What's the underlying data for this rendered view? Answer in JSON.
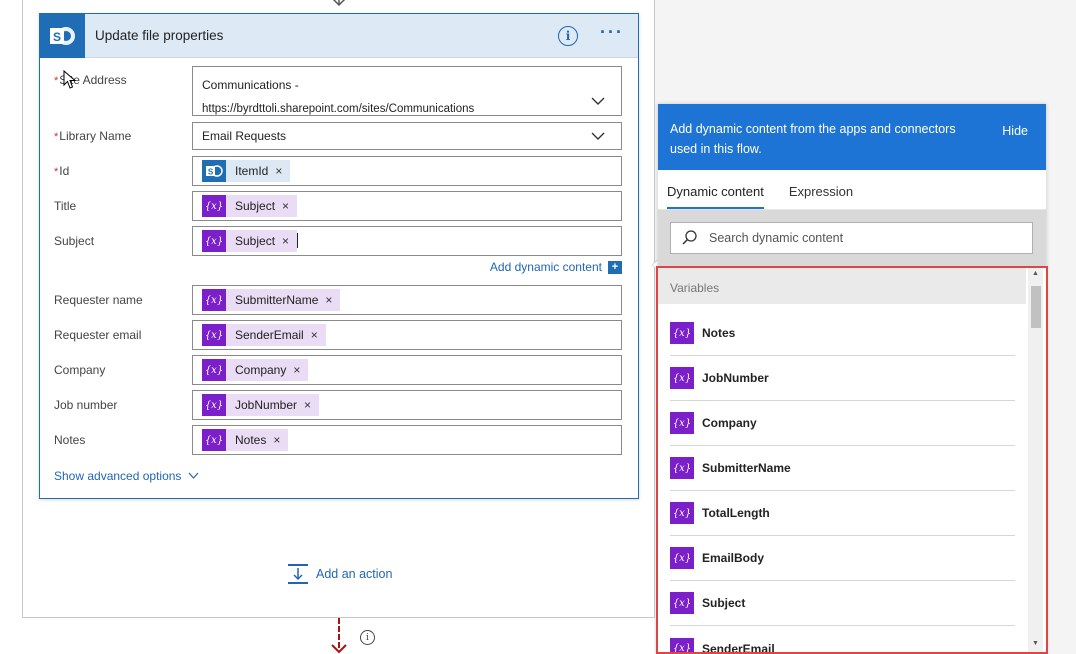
{
  "card": {
    "title": "Update file properties",
    "info": "i",
    "more": "···",
    "logo": "S"
  },
  "fields": {
    "site_address": {
      "label": "Site Address",
      "line1": "Communications -",
      "line2": "https://byrdttoli.sharepoint.com/sites/Communications"
    },
    "library_name": {
      "label": "Library Name",
      "value": "Email Requests"
    },
    "id": {
      "label": "Id",
      "token": "ItemId"
    },
    "title": {
      "label": "Title",
      "token": "Subject"
    },
    "subject": {
      "label": "Subject",
      "token": "Subject"
    },
    "add_dynamic": "Add dynamic content",
    "requester_name": {
      "label": "Requester name",
      "token": "SubmitterName"
    },
    "requester_email": {
      "label": "Requester email",
      "token": "SenderEmail"
    },
    "company": {
      "label": "Company",
      "token": "Company"
    },
    "job_number": {
      "label": "Job number",
      "token": "JobNumber"
    },
    "notes": {
      "label": "Notes",
      "token": "Notes"
    }
  },
  "required_mark": "*",
  "token_icon": "{x}",
  "remove_glyph": "×",
  "show_advanced": "Show advanced options",
  "add_action": "Add an action",
  "bottom_info": "i",
  "dynamic": {
    "header": "Add dynamic content from the apps and connectors used in this flow.",
    "hide": "Hide",
    "tabs": [
      "Dynamic content",
      "Expression"
    ],
    "search_placeholder": "Search dynamic content",
    "section": "Variables",
    "items": [
      "Notes",
      "JobNumber",
      "Company",
      "SubmitterName",
      "TotalLength",
      "EmailBody",
      "Subject",
      "SenderEmail"
    ]
  },
  "colors": {
    "accent": "#1e74d4",
    "variable": "#7a1fc9",
    "sharepoint": "#1f6db5",
    "highlight": "#e04545"
  }
}
